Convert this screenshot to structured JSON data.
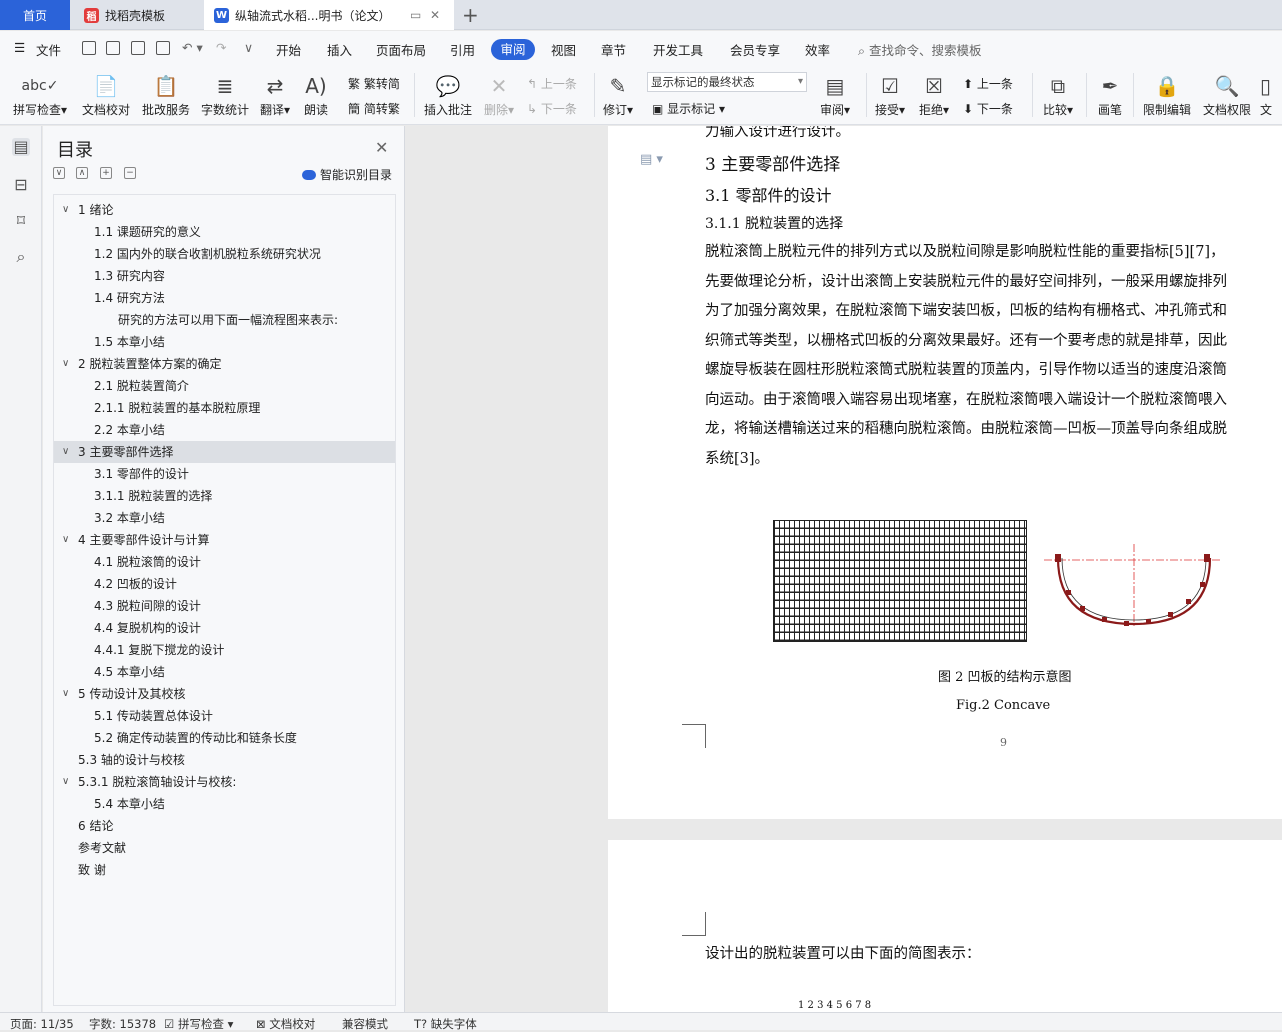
{
  "tabs": {
    "home": "首页",
    "template": "找稻壳模板",
    "doc": "纵轴流式水稻...明书（论文）"
  },
  "menu": {
    "file": "文件",
    "items": [
      "开始",
      "插入",
      "页面布局",
      "引用",
      "审阅",
      "视图",
      "章节",
      "开发工具",
      "会员专享",
      "效率"
    ],
    "active": "审阅",
    "search": "查找命令、搜索模板"
  },
  "ribbon": {
    "spell": "拼写检查",
    "doc_check": "文档校对",
    "batch": "批改服务",
    "word_count": "字数统计",
    "translate": "翻译",
    "read_aloud": "朗读",
    "trad_to_simp": "繁转简",
    "simp_to_trad": "简转繁",
    "insert_comment": "插入批注",
    "delete": "删除",
    "prev": "上一条",
    "next": "下一条",
    "revise": "修订",
    "markup_state": "显示标记的最终状态",
    "show_markup": "显示标记",
    "review": "审阅",
    "accept": "接受",
    "reject": "拒绝",
    "prev2": "上一条",
    "next2": "下一条",
    "compare": "比较",
    "pen": "画笔",
    "restrict": "限制编辑",
    "doc_rights": "文档权限",
    "doc_more": "文"
  },
  "toc": {
    "title": "目录",
    "smart": "智能识别目录",
    "rows": [
      {
        "label": "1    绪论",
        "arrow": "∨",
        "level": 0
      },
      {
        "label": "1.1    课题研究的意义",
        "level": 1
      },
      {
        "label": "1.2    国内外的联合收割机脱粒系统研究状况",
        "level": 1
      },
      {
        "label": "1.3    研究内容",
        "level": 1
      },
      {
        "label": "1.4    研究方法",
        "level": 1
      },
      {
        "label": "研究的方法可以用下面一幅流程图来表示:",
        "level": 2
      },
      {
        "label": "1.5    本章小结",
        "level": 1
      },
      {
        "label": "2    脱粒装置整体方案的确定",
        "arrow": "∨",
        "level": 0
      },
      {
        "label": "2.1    脱粒装置简介",
        "level": 1
      },
      {
        "label": "2.1.1    脱粒装置的基本脱粒原理",
        "level": 1
      },
      {
        "label": "2.2    本章小结",
        "level": 1
      },
      {
        "label": "3    主要零部件选择",
        "arrow": "∨",
        "level": 0,
        "selected": true
      },
      {
        "label": "3.1    零部件的设计",
        "level": 1
      },
      {
        "label": "3.1.1    脱粒装置的选择",
        "level": 1
      },
      {
        "label": "3.2    本章小结",
        "level": 1
      },
      {
        "label": "4    主要零部件设计与计算",
        "arrow": "∨",
        "level": 0
      },
      {
        "label": "4.1    脱粒滚筒的设计",
        "level": 1
      },
      {
        "label": "4.2    凹板的设计",
        "level": 1
      },
      {
        "label": "4.3    脱粒间隙的设计",
        "level": 1
      },
      {
        "label": "4.4    复脱机构的设计",
        "level": 1
      },
      {
        "label": "4.4.1    复脱下搅龙的设计",
        "level": 1
      },
      {
        "label": "4.5    本章小结",
        "level": 1
      },
      {
        "label": "5    传动设计及其校核",
        "arrow": "∨",
        "level": 0
      },
      {
        "label": "5.1    传动装置总体设计",
        "level": 1
      },
      {
        "label": "5.2    确定传动装置的传动比和链条长度",
        "level": 1
      },
      {
        "label": "5.3    轴的设计与校核",
        "level": 3
      },
      {
        "label": "5.3.1    脱粒滚筒轴设计与校核:",
        "arrow": "∨",
        "level": 4
      },
      {
        "label": "5.4    本章小结",
        "level": 1
      },
      {
        "label": "6    结论",
        "level": 3
      },
      {
        "label": "参考文献",
        "level": 3
      },
      {
        "label": "致      谢",
        "level": 3
      }
    ]
  },
  "doc": {
    "top_cut": "力输入设计进行设计。",
    "h1": "3    主要零部件选择",
    "h2": "3.1    零部件的设计",
    "h3": "3.1.1    脱粒装置的选择",
    "para": [
      "        脱粒滚筒上脱粒元件的排列方式以及脱粒间隙是影响脱粒性能的重要指标[5][7]，",
      "先要做理论分析，设计出滚筒上安装脱粒元件的最好空间排列，一般采用螺旋排列",
      "为了加强分离效果，在脱粒滚筒下端安装凹板，凹板的结构有栅格式、冲孔筛式和",
      "织筛式等类型，以栅格式凹板的分离效果最好。还有一个要考虑的就是排草，因此",
      "螺旋导板装在圆柱形脱粒滚筒式脱粒装置的顶盖内，引导作物以适当的速度沿滚筒",
      "向运动。由于滚筒喂入端容易出现堵塞，在脱粒滚筒喂入端设计一个脱粒滚筒喂入",
      "龙，将输送槽输送过来的稻穗向脱粒滚筒。由脱粒滚筒—凹板—顶盖导向条组成脱",
      "系统[3]。"
    ],
    "fig_cap_cn": "图 2    凹板的结构示意图",
    "fig_cap_en": "Fig.2    Concave",
    "page_num": "9",
    "page2_line": "        设计出的脱粒装置可以由下面的简图表示：",
    "page2_nums": "1    2        3    4    5        6    7    8"
  },
  "status": {
    "page": "页面: 11/35",
    "words": "字数: 15378",
    "spell": "拼写检查",
    "doc_check": "文档校对",
    "compat": "兼容模式",
    "missing_font": "缺失字体"
  },
  "colors": {
    "accent": "#2b63d9",
    "figure_red": "#8b1a1a"
  }
}
